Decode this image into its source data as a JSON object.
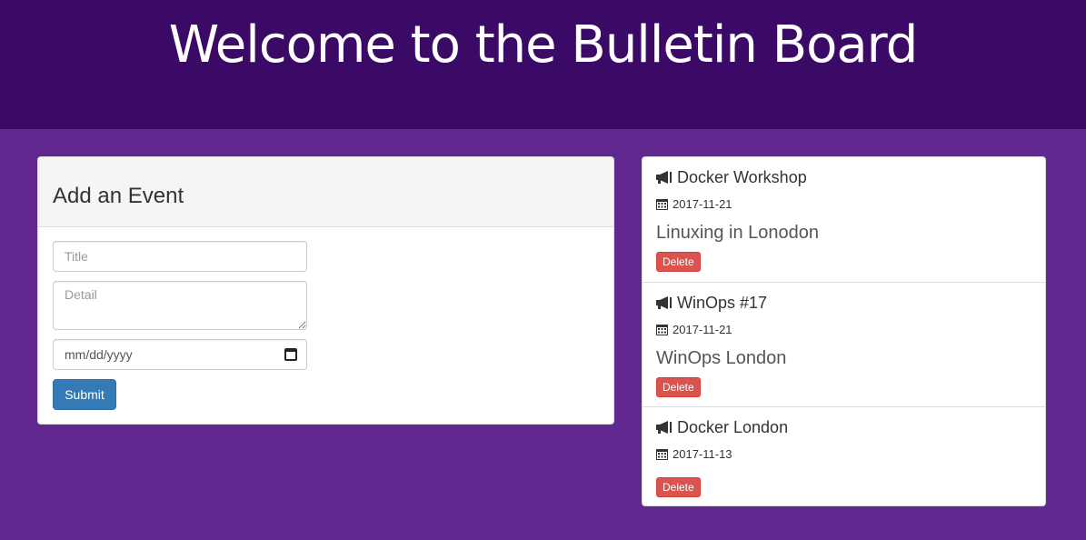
{
  "header": {
    "title": "Welcome to the Bulletin Board"
  },
  "form": {
    "heading": "Add an Event",
    "title_placeholder": "Title",
    "detail_placeholder": "Detail",
    "date_placeholder": "mm/dd/yyyy",
    "submit_label": "Submit"
  },
  "events": [
    {
      "title": "Docker Workshop",
      "date": "2017-11-21",
      "detail": "Linuxing in Lonodon",
      "delete_label": "Delete"
    },
    {
      "title": "WinOps #17",
      "date": "2017-11-21",
      "detail": "WinOps London",
      "delete_label": "Delete"
    },
    {
      "title": "Docker London",
      "date": "2017-11-13",
      "detail": "",
      "delete_label": "Delete"
    }
  ],
  "icons": {
    "event_icon": "bullhorn-icon",
    "date_icon": "calendar-icon"
  },
  "colors": {
    "header_bg": "#3a0a66",
    "page_bg": "#61288f",
    "submit_button": "#337ab7",
    "delete_button": "#d9534f"
  }
}
